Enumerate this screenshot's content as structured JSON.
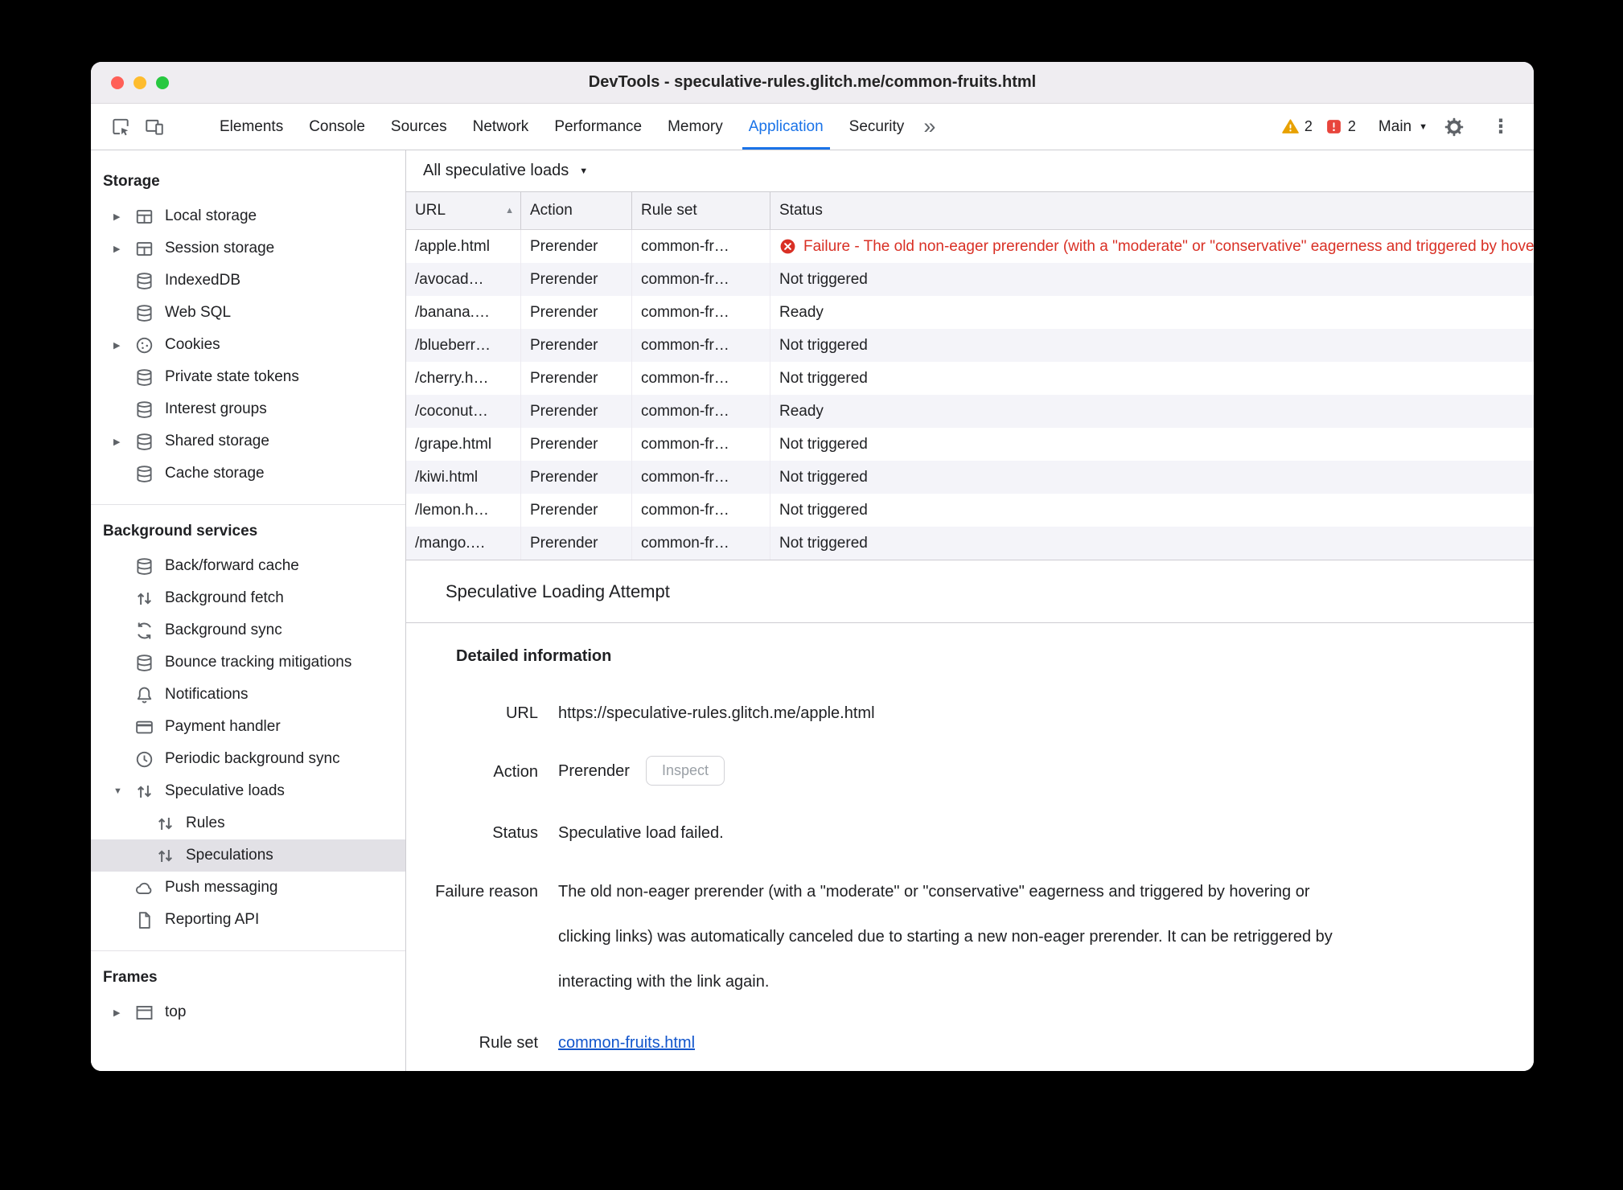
{
  "window": {
    "title": "DevTools - speculative-rules.glitch.me/common-fruits.html"
  },
  "toolbar": {
    "tabs": [
      "Elements",
      "Console",
      "Sources",
      "Network",
      "Performance",
      "Memory",
      "Application",
      "Security"
    ],
    "active_tab": "Application",
    "warning_count": "2",
    "issue_count": "2",
    "main_menu_label": "Main",
    "icons": [
      "inspect-element-icon",
      "device-toolbar-icon",
      "more-tabs-icon",
      "warning-icon",
      "issues-icon",
      "settings-gear-icon",
      "more-options-icon"
    ]
  },
  "sidebar": {
    "sections": [
      {
        "title": "Storage",
        "items": [
          {
            "label": "Local storage",
            "icon": "table-icon",
            "expandable": true
          },
          {
            "label": "Session storage",
            "icon": "table-icon",
            "expandable": true
          },
          {
            "label": "IndexedDB",
            "icon": "database-icon"
          },
          {
            "label": "Web SQL",
            "icon": "database-icon"
          },
          {
            "label": "Cookies",
            "icon": "cookie-icon",
            "expandable": true
          },
          {
            "label": "Private state tokens",
            "icon": "database-icon"
          },
          {
            "label": "Interest groups",
            "icon": "database-icon"
          },
          {
            "label": "Shared storage",
            "icon": "database-icon",
            "expandable": true
          },
          {
            "label": "Cache storage",
            "icon": "database-icon"
          }
        ]
      },
      {
        "title": "Background services",
        "items": [
          {
            "label": "Back/forward cache",
            "icon": "database-icon"
          },
          {
            "label": "Background fetch",
            "icon": "transfer-arrows-icon"
          },
          {
            "label": "Background sync",
            "icon": "sync-icon"
          },
          {
            "label": "Bounce tracking mitigations",
            "icon": "database-icon"
          },
          {
            "label": "Notifications",
            "icon": "bell-icon"
          },
          {
            "label": "Payment handler",
            "icon": "payment-card-icon"
          },
          {
            "label": "Periodic background sync",
            "icon": "clock-icon"
          },
          {
            "label": "Speculative loads",
            "icon": "transfer-arrows-icon",
            "expanded": true
          },
          {
            "label": "Rules",
            "icon": "transfer-arrows-icon",
            "child": true
          },
          {
            "label": "Speculations",
            "icon": "transfer-arrows-icon",
            "child": true,
            "selected": true
          },
          {
            "label": "Push messaging",
            "icon": "cloud-icon"
          },
          {
            "label": "Reporting API",
            "icon": "document-icon"
          }
        ]
      },
      {
        "title": "Frames",
        "items": [
          {
            "label": "top",
            "icon": "frame-icon",
            "expandable": true
          }
        ]
      }
    ]
  },
  "main": {
    "filter_label": "All speculative loads",
    "table": {
      "columns": [
        "URL",
        "Action",
        "Rule set",
        "Status"
      ],
      "sorted_by": "URL",
      "sort_direction": "ascending",
      "rows": [
        {
          "url": "/apple.html",
          "action": "Prerender",
          "rule_set": "common-fr…",
          "status": "Failure - The old non-eager prerender (with a \"moderate\" or \"conservative\" eagerness and triggered by hovering or clicking links) was automatically canceled due to starting a new non-eager prerender. It can be retriggered by interacting with the link again.",
          "status_type": "failure"
        },
        {
          "url": "/avocad…",
          "action": "Prerender",
          "rule_set": "common-fr…",
          "status": "Not triggered",
          "status_type": "normal"
        },
        {
          "url": "/banana.…",
          "action": "Prerender",
          "rule_set": "common-fr…",
          "status": "Ready",
          "status_type": "normal"
        },
        {
          "url": "/blueberr…",
          "action": "Prerender",
          "rule_set": "common-fr…",
          "status": "Not triggered",
          "status_type": "normal"
        },
        {
          "url": "/cherry.h…",
          "action": "Prerender",
          "rule_set": "common-fr…",
          "status": "Not triggered",
          "status_type": "normal"
        },
        {
          "url": "/coconut…",
          "action": "Prerender",
          "rule_set": "common-fr…",
          "status": "Ready",
          "status_type": "normal"
        },
        {
          "url": "/grape.html",
          "action": "Prerender",
          "rule_set": "common-fr…",
          "status": "Not triggered",
          "status_type": "normal"
        },
        {
          "url": "/kiwi.html",
          "action": "Prerender",
          "rule_set": "common-fr…",
          "status": "Not triggered",
          "status_type": "normal"
        },
        {
          "url": "/lemon.h…",
          "action": "Prerender",
          "rule_set": "common-fr…",
          "status": "Not triggered",
          "status_type": "normal"
        },
        {
          "url": "/mango.…",
          "action": "Prerender",
          "rule_set": "common-fr…",
          "status": "Not triggered",
          "status_type": "normal"
        }
      ]
    },
    "details": {
      "title": "Speculative Loading Attempt",
      "heading": "Detailed information",
      "url_label": "URL",
      "url_value": "https://speculative-rules.glitch.me/apple.html",
      "action_label": "Action",
      "action_value": "Prerender",
      "inspect_button": "Inspect",
      "status_label": "Status",
      "status_value": "Speculative load failed.",
      "failure_label": "Failure reason",
      "failure_value": "The old non-eager prerender (with a \"moderate\" or \"conservative\" eagerness and triggered by hovering or clicking links) was automatically canceled due to starting a new non-eager prerender. It can be retriggered by interacting with the link again.",
      "rule_set_label": "Rule set",
      "rule_set_link": "common-fruits.html"
    }
  },
  "colors": {
    "accent_blue": "#1a73e8",
    "failure_red": "#d93025",
    "warning_orange": "#e8a100",
    "issue_red": "#e8453c",
    "link_blue": "#1155cc",
    "selection_gray": "#e2e1e6",
    "row_stripe": "#f4f4f9"
  }
}
